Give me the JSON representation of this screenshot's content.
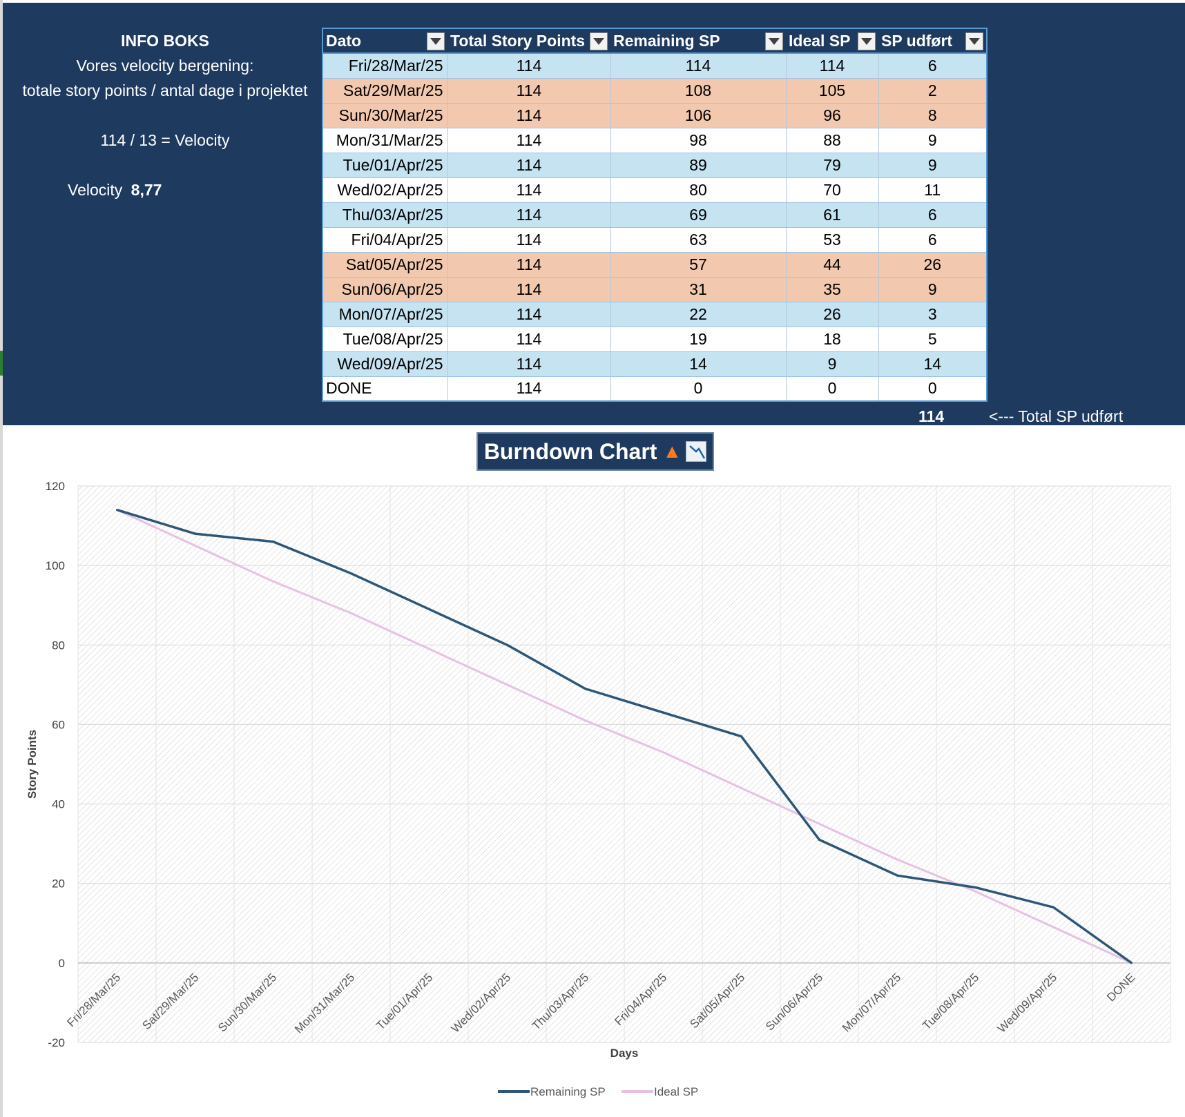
{
  "info": {
    "title": "INFO BOKS",
    "line1": "Vores velocity bergening:",
    "line2": "totale story points / antal dage i projektet",
    "formula": "114 / 13 = Velocity",
    "velocity_label": "Velocity",
    "velocity_value": "8,77"
  },
  "table": {
    "headers": [
      "Dato",
      "Total Story Points",
      "Remaining SP",
      "Ideal SP",
      "SP udført"
    ],
    "rows": [
      {
        "style": "blue",
        "cells": [
          "Fri/28/Mar/25",
          "114",
          "114",
          "114",
          "6"
        ]
      },
      {
        "style": "peach",
        "cells": [
          "Sat/29/Mar/25",
          "114",
          "108",
          "105",
          "2"
        ]
      },
      {
        "style": "peach",
        "cells": [
          "Sun/30/Mar/25",
          "114",
          "106",
          "96",
          "8"
        ]
      },
      {
        "style": "white",
        "cells": [
          "Mon/31/Mar/25",
          "114",
          "98",
          "88",
          "9"
        ]
      },
      {
        "style": "blue",
        "cells": [
          "Tue/01/Apr/25",
          "114",
          "89",
          "79",
          "9"
        ]
      },
      {
        "style": "white",
        "cells": [
          "Wed/02/Apr/25",
          "114",
          "80",
          "70",
          "11"
        ]
      },
      {
        "style": "blue",
        "cells": [
          "Thu/03/Apr/25",
          "114",
          "69",
          "61",
          "6"
        ]
      },
      {
        "style": "white",
        "cells": [
          "Fri/04/Apr/25",
          "114",
          "63",
          "53",
          "6"
        ]
      },
      {
        "style": "peach",
        "cells": [
          "Sat/05/Apr/25",
          "114",
          "57",
          "44",
          "26"
        ]
      },
      {
        "style": "peach",
        "cells": [
          "Sun/06/Apr/25",
          "114",
          "31",
          "35",
          "9"
        ]
      },
      {
        "style": "blue",
        "cells": [
          "Mon/07/Apr/25",
          "114",
          "22",
          "26",
          "3"
        ]
      },
      {
        "style": "white",
        "cells": [
          "Tue/08/Apr/25",
          "114",
          "19",
          "18",
          "5"
        ]
      },
      {
        "style": "blue",
        "cells": [
          "Wed/09/Apr/25",
          "114",
          "14",
          "9",
          "14"
        ]
      },
      {
        "style": "white",
        "cells": [
          "DONE",
          "114",
          "0",
          "0",
          "0"
        ]
      }
    ],
    "total_value": "114",
    "total_label": "<--- Total SP udført"
  },
  "colors": {
    "panel": "#1f3a5f",
    "row_blue": "#c6e3f2",
    "row_peach": "#f2c9ae",
    "remaining_line": "#2d5677",
    "ideal_line": "#e6c1e3"
  },
  "chart_data": {
    "type": "line",
    "title": "Burndown Chart",
    "title_icons": [
      "fire-emoji",
      "chart-decreasing-emoji"
    ],
    "xlabel": "Days",
    "ylabel": "Story Points",
    "ylim": [
      -20,
      120
    ],
    "yticks": [
      -20,
      0,
      20,
      40,
      60,
      80,
      100,
      120
    ],
    "grid": true,
    "legend": "bottom",
    "categories": [
      "Fri/28/Mar/25",
      "Sat/29/Mar/25",
      "Sun/30/Mar/25",
      "Mon/31/Mar/25",
      "Tue/01/Apr/25",
      "Wed/02/Apr/25",
      "Thu/03/Apr/25",
      "Fri/04/Apr/25",
      "Sat/05/Apr/25",
      "Sun/06/Apr/25",
      "Mon/07/Apr/25",
      "Tue/08/Apr/25",
      "Wed/09/Apr/25",
      "DONE"
    ],
    "series": [
      {
        "name": "Remaining SP",
        "color": "#2d5677",
        "values": [
          114,
          108,
          106,
          98,
          89,
          80,
          69,
          63,
          57,
          31,
          22,
          19,
          14,
          0
        ]
      },
      {
        "name": "Ideal SP",
        "color": "#e6c1e3",
        "values": [
          114,
          105,
          96,
          88,
          79,
          70,
          61,
          53,
          44,
          35,
          26,
          18,
          9,
          0
        ]
      }
    ]
  }
}
